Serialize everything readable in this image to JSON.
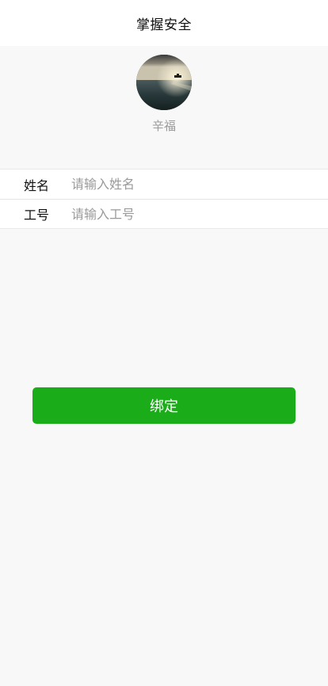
{
  "header": {
    "title": "掌握安全"
  },
  "profile": {
    "avatar_icon": "avatar-sea-photo",
    "nickname": "辛福"
  },
  "form": {
    "name": {
      "label": "姓名",
      "placeholder": "请输入姓名",
      "value": ""
    },
    "employee_id": {
      "label": "工号",
      "placeholder": "请输入工号",
      "value": ""
    }
  },
  "actions": {
    "bind_label": "绑定"
  },
  "colors": {
    "primary_button": "#1aad19",
    "page_background": "#f8f8f8",
    "placeholder_text": "#9a9a9a"
  }
}
